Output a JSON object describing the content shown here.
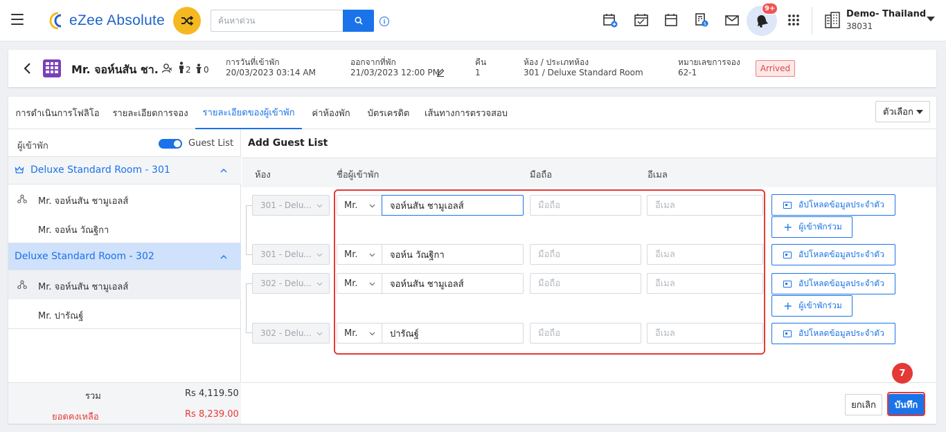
{
  "app": {
    "logo_text": "eZee Absolute",
    "search_placeholder": "ค้นหาด่วน",
    "notification_count": "9+",
    "hotel_name": "Demo- Thailand",
    "hotel_code": "38031"
  },
  "reservation": {
    "guest_name": "Mr. จอห์นสัน ชา...",
    "adults": "2",
    "children": "0",
    "arrival_label": "การวันที่เข้าพัก",
    "arrival_value": "20/03/2023 03:14 AM",
    "departure_label": "ออกจากที่พัก",
    "departure_value": "21/03/2023 12:00 PM",
    "nights_label": "คืน",
    "nights_value": "1",
    "room_label": "ห้อง / ประเภทห้อง",
    "room_value": "301 / Deluxe Standard Room",
    "res_no_label": "หมายเลขการจอง",
    "res_no_value": "62-1",
    "status": "Arrived"
  },
  "tabs": [
    {
      "label": "การดำเนินการโฟลิโอ"
    },
    {
      "label": "รายละเอียดการจอง"
    },
    {
      "label": "รายละเอียดของผู้เข้าพัก"
    },
    {
      "label": "ค่าห้องพัก"
    },
    {
      "label": "บัตรเครดิต"
    },
    {
      "label": "เส้นทางการตรวจสอบ"
    }
  ],
  "options_label": "ตัวเลือก",
  "left_panel": {
    "title": "ผู้เข้าพัก",
    "toggle_label": "Guest List",
    "groups": [
      {
        "room": "Deluxe Standard Room - 301",
        "guests": [
          "Mr. จอห์นสัน ชามูเอลส์",
          "Mr. จอห์น วัณฐิกา"
        ]
      },
      {
        "room": "Deluxe Standard Room - 302",
        "guests": [
          "Mr. จอห์นสัน ชามูเอลส์",
          "Mr. ปารัณฐ์"
        ]
      }
    ],
    "total_label": "รวม",
    "total_value": "Rs 4,119.50",
    "balance_label": "ยอดคงเหลือ",
    "balance_value": "Rs 8,239.00"
  },
  "guest_list": {
    "title": "Add Guest List",
    "headers": {
      "room": "ห้อง",
      "name": "ชื่อผู้เข้าพัก",
      "mobile": "มือถือ",
      "email": "อีเมล"
    },
    "mobile_placeholder": "มือถือ",
    "email_placeholder": "อีเมล",
    "rows": [
      {
        "room": "301 - Delu...",
        "salutation": "Mr.",
        "name": "จอห์นสัน ชามูเอลส์"
      },
      {
        "room": "301 - Delu...",
        "salutation": "Mr.",
        "name": "จอห์น วัณฐิกา"
      },
      {
        "room": "302 - Delu...",
        "salutation": "Mr.",
        "name": "จอห์นสัน ชามูเอลส์"
      },
      {
        "room": "302 - Delu...",
        "salutation": "Mr.",
        "name": "ปารัณฐ์"
      }
    ],
    "upload_label": "อัปโหลดข้อมูลประจำตัว",
    "cohabitant_label": "ผู้เข้าพักร่วม",
    "cancel_label": "ยกเลิก",
    "save_label": "บันทึก"
  },
  "step_number": "7",
  "colors": {
    "primary": "#1a73e8",
    "accent": "#f5b820",
    "danger": "#e53935",
    "brand_purple": "#7b3fb8"
  }
}
